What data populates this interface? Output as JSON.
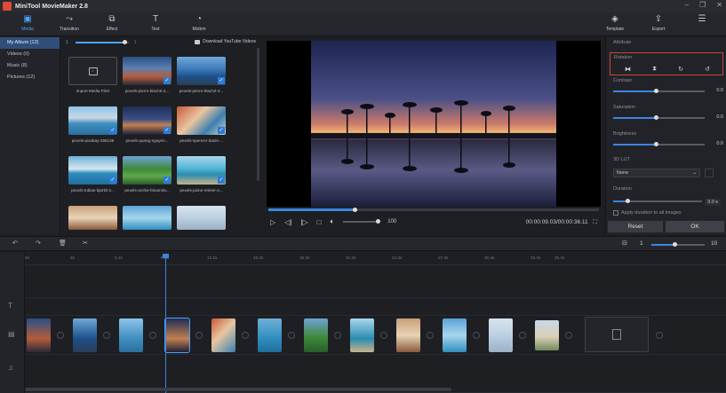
{
  "app": {
    "title": "MiniTool MovieMaker 2.8"
  },
  "toolbar": {
    "media": "Media",
    "transition": "Transition",
    "effect": "Effect",
    "text": "Text",
    "motion": "Motion",
    "template": "Template",
    "export": "Export"
  },
  "sidebar": {
    "items": [
      {
        "label": "My Album (12)"
      },
      {
        "label": "Videos (0)"
      },
      {
        "label": "Music (8)"
      },
      {
        "label": "Pictures (12)"
      }
    ]
  },
  "media": {
    "zoom_value": 1,
    "download_label": "Download YouTube Videos",
    "import_label": "Import Media Files",
    "items": [
      {
        "caption": "pexels-pierre-blaché-2..."
      },
      {
        "caption": "pexels-pierre-blaché-3..."
      },
      {
        "caption": "pexels-pixabay-258138"
      },
      {
        "caption": "pexels-quang-nguyen..."
      },
      {
        "caption": "pexels-spencer-davis-..."
      },
      {
        "caption": "pexels-tobias-bjørkli-2..."
      },
      {
        "caption": "pexels-archie-binamira..."
      },
      {
        "caption": "pexels-jaime-reimer-2..."
      }
    ]
  },
  "preview": {
    "progress": 0.26,
    "volume": "100",
    "timecode": "00:00:09.03/00:00:36.11"
  },
  "properties": {
    "heading": "Attribute",
    "rotation_label": "Rotation",
    "contrast_label": "Contrast",
    "contrast_value": "0.0",
    "saturation_label": "Saturation",
    "saturation_value": "0.0",
    "brightness_label": "Brightness",
    "brightness_value": "0.0",
    "lut_label": "3D LUT",
    "lut_value": "None",
    "duration_label": "Duration",
    "duration_value": "3.0 s",
    "apply_label": "Apply duration to all images",
    "reset_label": "Reset",
    "ok_label": "OK"
  },
  "timeline": {
    "zoom_min": "1",
    "zoom_max": "10",
    "zoom_level": 0.4,
    "ruler": [
      "0s",
      "3s",
      "6.1s",
      "9.1s",
      "12.2s",
      "15.2s",
      "18.3s",
      "21.3s",
      "24.3s",
      "27.3s",
      "30.4s",
      "33.4s",
      "35.4s"
    ]
  },
  "colors": {
    "accent": "#3a86e0",
    "selection": "#2f4f7a",
    "highlight_border": "#c9453b"
  }
}
